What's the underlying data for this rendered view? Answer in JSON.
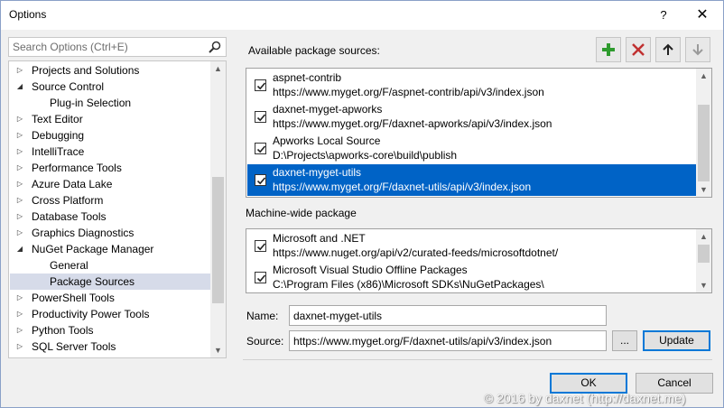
{
  "window": {
    "title": "Options",
    "help_glyph": "?",
    "close_glyph": "✕"
  },
  "search": {
    "placeholder": "Search Options (Ctrl+E)"
  },
  "tree": {
    "items": [
      {
        "label": "Projects and Solutions",
        "expander": "collapsed"
      },
      {
        "label": "Source Control",
        "expander": "expanded"
      },
      {
        "label": "Plug-in Selection",
        "expander": "none"
      },
      {
        "label": "Text Editor",
        "expander": "collapsed"
      },
      {
        "label": "Debugging",
        "expander": "collapsed"
      },
      {
        "label": "IntelliTrace",
        "expander": "collapsed"
      },
      {
        "label": "Performance Tools",
        "expander": "collapsed"
      },
      {
        "label": "Azure Data Lake",
        "expander": "collapsed"
      },
      {
        "label": "Cross Platform",
        "expander": "collapsed"
      },
      {
        "label": "Database Tools",
        "expander": "collapsed"
      },
      {
        "label": "Graphics Diagnostics",
        "expander": "collapsed"
      },
      {
        "label": "NuGet Package Manager",
        "expander": "expanded"
      },
      {
        "label": "General",
        "expander": "none"
      },
      {
        "label": "Package Sources",
        "expander": "none",
        "selected": true
      },
      {
        "label": "PowerShell Tools",
        "expander": "collapsed"
      },
      {
        "label": "Productivity Power Tools",
        "expander": "collapsed"
      },
      {
        "label": "Python Tools",
        "expander": "collapsed"
      },
      {
        "label": "SQL Server Tools",
        "expander": "collapsed"
      }
    ]
  },
  "available": {
    "label": "Available package sources:",
    "sources": [
      {
        "name": "aspnet-contrib",
        "url": "https://www.myget.org/F/aspnet-contrib/api/v3/index.json",
        "checked": true
      },
      {
        "name": "daxnet-myget-apworks",
        "url": "https://www.myget.org/F/daxnet-apworks/api/v3/index.json",
        "checked": true
      },
      {
        "name": "Apworks Local Source",
        "url": "D:\\Projects\\apworks-core\\build\\publish",
        "checked": true
      },
      {
        "name": "daxnet-myget-utils",
        "url": "https://www.myget.org/F/daxnet-utils/api/v3/index.json",
        "checked": true,
        "selected": true
      }
    ]
  },
  "machine_wide": {
    "label": "Machine-wide package",
    "sources": [
      {
        "name": "Microsoft and .NET",
        "url": "https://www.nuget.org/api/v2/curated-feeds/microsoftdotnet/",
        "checked": true
      },
      {
        "name": "Microsoft Visual Studio Offline Packages",
        "url": "C:\\Program Files (x86)\\Microsoft SDKs\\NuGetPackages\\",
        "checked": true
      }
    ]
  },
  "form": {
    "name_label": "Name:",
    "name_value": "daxnet-myget-utils",
    "source_label": "Source:",
    "source_value": "https://www.myget.org/F/daxnet-utils/api/v3/index.json",
    "browse_label": "...",
    "update_label": "Update"
  },
  "footer": {
    "ok_label": "OK",
    "cancel_label": "Cancel"
  },
  "watermark": "© 2016 by daxnet (http://daxnet.me)",
  "colors": {
    "selection": "#0063c6",
    "add": "#2e9b2e",
    "remove": "#c03030"
  }
}
